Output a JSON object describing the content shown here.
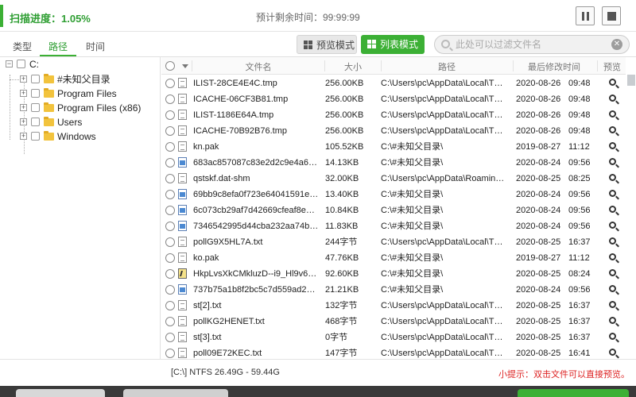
{
  "topbar": {
    "scan_progress": "扫描进度：1.05%",
    "eta": "预计剩余时间：99:99:99"
  },
  "toolbar": {
    "tabs": [
      "类型",
      "路径",
      "时间"
    ],
    "active_tab": "路径",
    "preview_mode": "预览模式",
    "list_mode": "列表模式",
    "search_placeholder": "此处可以过滤文件名"
  },
  "tree": {
    "root": "C:",
    "children": [
      "#未知父目录",
      "Program Files",
      "Program Files (x86)",
      "Users",
      "Windows"
    ]
  },
  "columns": {
    "name": "文件名",
    "size": "大小",
    "path": "路径",
    "modified": "最后修改时间",
    "preview": "预览"
  },
  "files": [
    {
      "icon": "doc",
      "name": "ILIST-28CE4E4C.tmp",
      "size": "256.00KB",
      "path": "C:\\Users\\pc\\AppData\\Local\\T…",
      "date": "2020-08-26",
      "time": "09:48"
    },
    {
      "icon": "doc",
      "name": "ICACHE-06CF3B81.tmp",
      "size": "256.00KB",
      "path": "C:\\Users\\pc\\AppData\\Local\\T…",
      "date": "2020-08-26",
      "time": "09:48"
    },
    {
      "icon": "doc",
      "name": "ILIST-1186E64A.tmp",
      "size": "256.00KB",
      "path": "C:\\Users\\pc\\AppData\\Local\\T…",
      "date": "2020-08-26",
      "time": "09:48"
    },
    {
      "icon": "doc",
      "name": "ICACHE-70B92B76.tmp",
      "size": "256.00KB",
      "path": "C:\\Users\\pc\\AppData\\Local\\T…",
      "date": "2020-08-26",
      "time": "09:48"
    },
    {
      "icon": "doc",
      "name": "kn.pak",
      "size": "105.52KB",
      "path": "C:\\#未知父目录\\",
      "date": "2019-08-27",
      "time": "11:12"
    },
    {
      "icon": "img",
      "name": "683ac857087c83e2d2c9e4a6…",
      "size": "14.13KB",
      "path": "C:\\#未知父目录\\",
      "date": "2020-08-24",
      "time": "09:56"
    },
    {
      "icon": "doc",
      "name": "qstskf.dat-shm",
      "size": "32.00KB",
      "path": "C:\\Users\\pc\\AppData\\Roamin…",
      "date": "2020-08-25",
      "time": "08:25"
    },
    {
      "icon": "img",
      "name": "69bb9c8efa0f723e64041591e…",
      "size": "13.40KB",
      "path": "C:\\#未知父目录\\",
      "date": "2020-08-24",
      "time": "09:56"
    },
    {
      "icon": "img",
      "name": "6c073cb29af7d42669cfeaf8e…",
      "size": "10.84KB",
      "path": "C:\\#未知父目录\\",
      "date": "2020-08-24",
      "time": "09:56"
    },
    {
      "icon": "img",
      "name": "7346542995d44cba232aa74b…",
      "size": "11.83KB",
      "path": "C:\\#未知父目录\\",
      "date": "2020-08-24",
      "time": "09:56"
    },
    {
      "icon": "doc",
      "name": "pollG9X5HL7A.txt",
      "size": "244字节",
      "path": "C:\\Users\\pc\\AppData\\Local\\T…",
      "date": "2020-08-25",
      "time": "16:37"
    },
    {
      "icon": "doc",
      "name": "ko.pak",
      "size": "47.76KB",
      "path": "C:\\#未知父目录\\",
      "date": "2019-08-27",
      "time": "11:12"
    },
    {
      "icon": "exe",
      "name": "HkpLvsXkCMkluzD--i9_Hl9v6…",
      "size": "92.60KB",
      "path": "C:\\#未知父目录\\",
      "date": "2020-08-25",
      "time": "08:24"
    },
    {
      "icon": "img",
      "name": "737b75a1b8f2bc5c7d559ad2…",
      "size": "21.21KB",
      "path": "C:\\#未知父目录\\",
      "date": "2020-08-24",
      "time": "09:56"
    },
    {
      "icon": "doc",
      "name": "st[2].txt",
      "size": "132字节",
      "path": "C:\\Users\\pc\\AppData\\Local\\T…",
      "date": "2020-08-25",
      "time": "16:37"
    },
    {
      "icon": "doc",
      "name": "pollKG2HENET.txt",
      "size": "468字节",
      "path": "C:\\Users\\pc\\AppData\\Local\\T…",
      "date": "2020-08-25",
      "time": "16:37"
    },
    {
      "icon": "doc",
      "name": "st[3].txt",
      "size": "0字节",
      "path": "C:\\Users\\pc\\AppData\\Local\\T…",
      "date": "2020-08-25",
      "time": "16:37"
    },
    {
      "icon": "doc",
      "name": "poll09E72KEC.txt",
      "size": "147字节",
      "path": "C:\\Users\\pc\\AppData\\Local\\T…",
      "date": "2020-08-25",
      "time": "16:41"
    }
  ],
  "status": {
    "disk": "[C:\\] NTFS 26.49G - 59.44G",
    "tip": "小提示：双击文件可以直接预览。"
  },
  "colors": {
    "accent": "#3cb035",
    "tip": "#dd2222"
  }
}
